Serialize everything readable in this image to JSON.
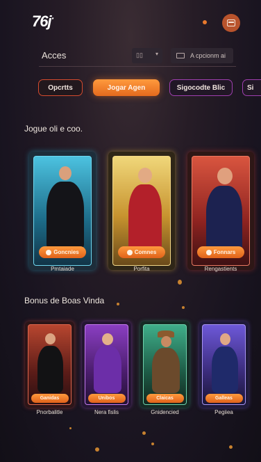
{
  "header": {
    "logo": "76j",
    "logo_mark": "·",
    "menu_icon": "wallet-icon"
  },
  "filter_bar": {
    "label": "Acces",
    "select1": "▯▯",
    "select2": "A cpcionm ai"
  },
  "pills": [
    "Opcrtts",
    "Jogar Agen",
    "Sigocodte Blic",
    "Si"
  ],
  "sections": [
    {
      "title": "Jogue oli e coo.",
      "cards": [
        {
          "button": "Goncnies",
          "caption": "Pmtaiade",
          "theme": "#2aa7c7"
        },
        {
          "button": "Comnes",
          "caption": "Porfita",
          "theme": "#e0b53a"
        },
        {
          "button": "Fonnars",
          "caption": "Rengastients",
          "theme": "#c6392e"
        }
      ]
    },
    {
      "title": "Bonus de Boas  Vinda",
      "cards": [
        {
          "button": "Ganidas",
          "caption": "Pnorbalitle",
          "theme": "#d6433a"
        },
        {
          "button": "Unibos",
          "caption": "Nera fislis",
          "theme": "#a14bd6"
        },
        {
          "button": "Claicas",
          "caption": "Gnidencied",
          "theme": "#2fa27a"
        },
        {
          "button": "Galleas",
          "caption": "Pegiiea",
          "theme": "#7357d8"
        }
      ]
    }
  ]
}
